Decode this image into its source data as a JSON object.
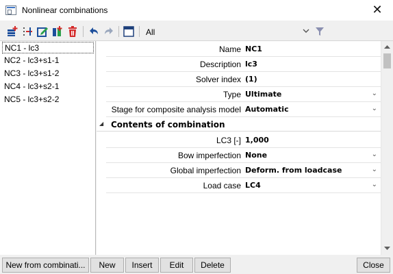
{
  "window": {
    "title": "Nonlinear combinations",
    "close_glyph": "✕"
  },
  "toolbar": {
    "filter_value": "All",
    "icons": [
      "add-icon",
      "insert-icon",
      "edit-icon",
      "duplicate-icon",
      "delete-icon",
      "undo-icon",
      "redo-icon",
      "table-view-icon",
      "dropdown-icon",
      "filter-icon"
    ]
  },
  "list": {
    "items": [
      {
        "label": "NC1 - lc3"
      },
      {
        "label": "NC2 - lc3+s1-1"
      },
      {
        "label": "NC3 - lc3+s1-2"
      },
      {
        "label": "NC4 - lc3+s2-1"
      },
      {
        "label": "NC5 - lc3+s2-2"
      }
    ],
    "selected_index": 0
  },
  "properties": {
    "rows": [
      {
        "label": "Name",
        "value": "NC1"
      },
      {
        "label": "Description",
        "value": "lc3"
      },
      {
        "label": "Solver index",
        "value": "(1)"
      },
      {
        "label": "Type",
        "value": "Ultimate"
      },
      {
        "label": "Stage for composite analysis model",
        "value": "Automatic"
      }
    ],
    "section": {
      "title": "Contents of combination",
      "toggle_glyph": "◢"
    },
    "section_rows": [
      {
        "label": "LC3 [-]",
        "value": "1,000"
      },
      {
        "label": "Bow imperfection",
        "value": "None"
      },
      {
        "label": "Global imperfection",
        "value": "Deform. from loadcase"
      },
      {
        "label": "Load case",
        "value": "LC4"
      }
    ],
    "dropdown_glyph": "⌄"
  },
  "buttons": {
    "new_from": "New from combinati...",
    "new": "New",
    "insert": "Insert",
    "edit": "Edit",
    "delete": "Delete",
    "close": "Close"
  },
  "colors": {
    "toolbar_icon_blue": "#1d4f9c",
    "toolbar_icon_red": "#d42a2a",
    "toolbar_icon_green": "#2aa04a",
    "filter_funnel": "#8a8fb0"
  }
}
